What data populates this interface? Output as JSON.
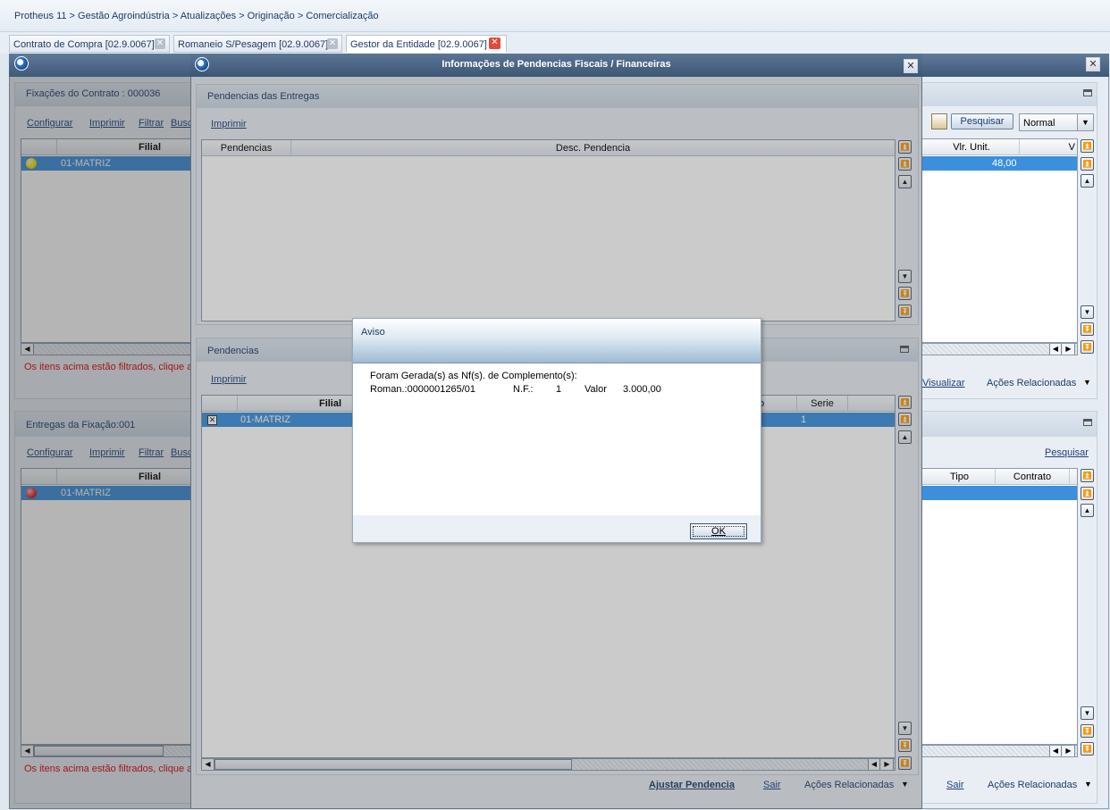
{
  "breadcrumb": "Protheus 11 > Gestão Agroindústria > Atualizações > Originação > Comercialização",
  "tabs": [
    {
      "label": "Contrato de Compra [02.9.0067]"
    },
    {
      "label": "Romaneio S/Pesagem [02.9.0067]"
    },
    {
      "label": "Gestor da Entidade [02.9.0067]"
    }
  ],
  "main": {
    "fixacoes": {
      "title": "Fixações do Contrato : 000036",
      "toolbar": {
        "configurar": "Configurar",
        "imprimir": "Imprimir",
        "filtrar": "Filtrar",
        "buscar": "Busc"
      },
      "headers": {
        "filial": "Filial",
        "vlr_unit": "Vlr. Unit.",
        "v": "V"
      },
      "row": {
        "filial": "01-MATRIZ",
        "vlr_unit": "48,00"
      },
      "status_color": "#f5e000",
      "search_button": "Pesquisar",
      "order_select": "Normal",
      "filter_msg": "Os itens acima estão filtrados, clique a",
      "visualizar": "Visualizar",
      "acoes": "Ações Relacionadas"
    },
    "entregas": {
      "title": "Entregas da Fixação:001",
      "toolbar": {
        "configurar": "Configurar",
        "imprimir": "Imprimir",
        "filtrar": "Filtrar",
        "buscar": "Busc"
      },
      "headers": {
        "filial": "Filial",
        "tipo": "Tipo",
        "contrato": "Contrato"
      },
      "row": {
        "filial": "01-MATRIZ"
      },
      "status_color": "#e02020",
      "pesquisar": "Pesquisar",
      "filter_msg": "Os itens acima estão filtrados, clique a",
      "sair": "Sair",
      "acoes": "Ações Relacionadas"
    }
  },
  "pend_window": {
    "title": "Informações de Pendencias Fiscais / Financeiras",
    "entregas_panel": {
      "title": "Pendencias  das Entregas",
      "imprimir": "Imprimir",
      "headers": {
        "pendencias": "Pendencias",
        "desc": "Desc. Pendencia"
      }
    },
    "pend_panel": {
      "title": "Pendencias",
      "imprimir": "Imprimir",
      "headers": {
        "filial": "Filial",
        "to": "to",
        "serie": "Serie"
      },
      "row": {
        "filial": "01-MATRIZ",
        "serie": "1"
      }
    },
    "footer": {
      "ajustar": "Ajustar Pendencia",
      "sair": "Sair",
      "acoes": "Ações Relacionadas"
    }
  },
  "aviso": {
    "title": "Aviso",
    "line1": "Foram Gerada(s) as Nf(s). de Complemento(s):",
    "roman": "Roman.:0000001265/01",
    "nf_label": "N.F.:",
    "nf_value": "1",
    "valor_label": "Valor",
    "valor_value": "3.000,00",
    "ok": "OK"
  }
}
